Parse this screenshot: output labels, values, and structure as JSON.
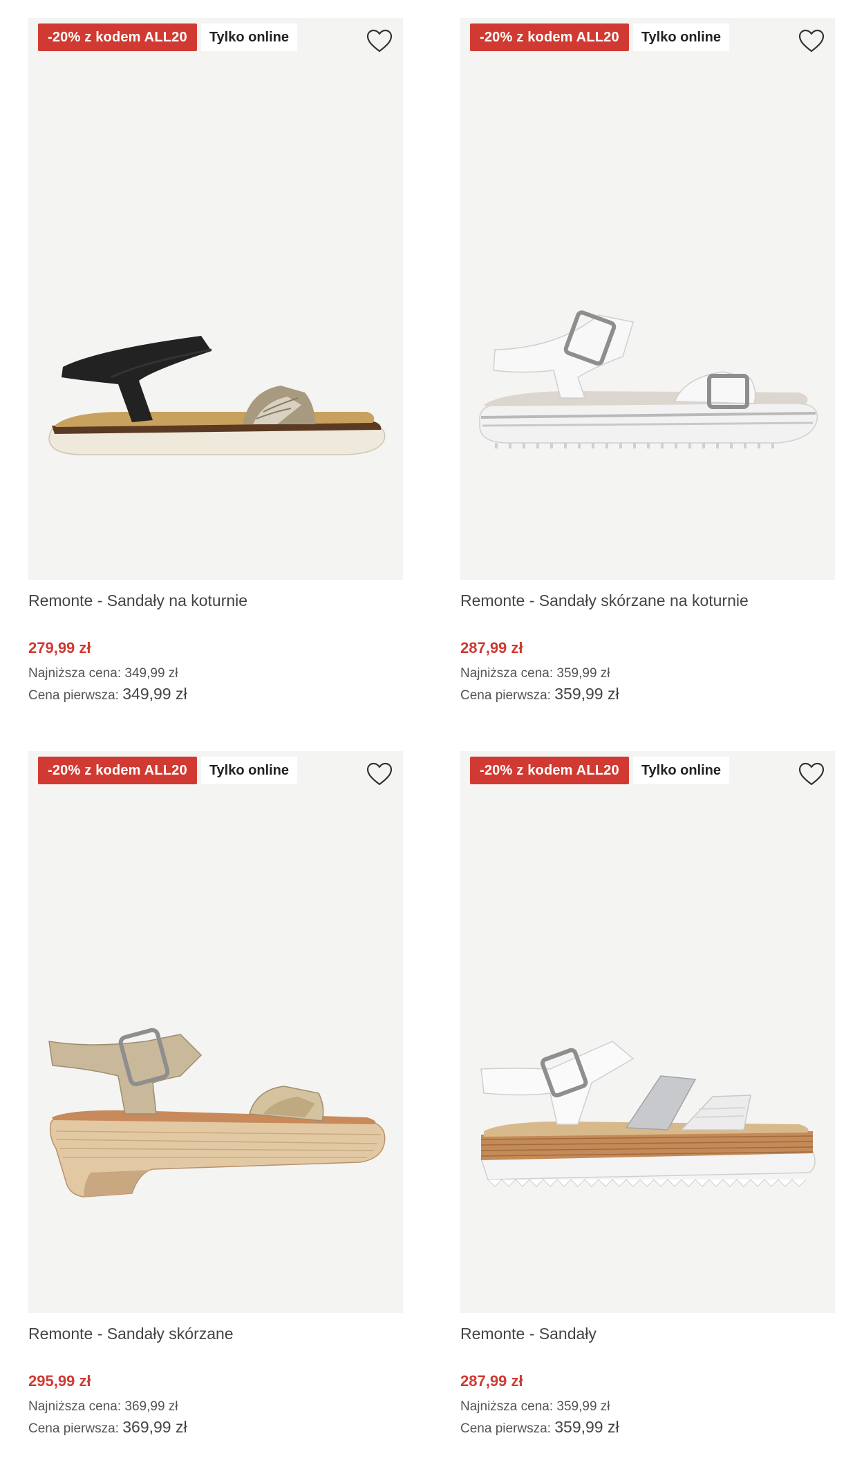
{
  "products": [
    {
      "promo_badge": "-20% z kodem ALL20",
      "online_badge": "Tylko online",
      "title": "Remonte - Sandały na koturnie",
      "price": "279,99 zł",
      "lowest_label": "Najniższa cena:",
      "lowest_value": "349,99 zł",
      "first_label": "Cena pierwsza:",
      "first_value": "349,99 zł"
    },
    {
      "promo_badge": "-20% z kodem ALL20",
      "online_badge": "Tylko online",
      "title": "Remonte - Sandały skórzane na koturnie",
      "price": "287,99 zł",
      "lowest_label": "Najniższa cena:",
      "lowest_value": "359,99 zł",
      "first_label": "Cena pierwsza:",
      "first_value": "359,99 zł"
    },
    {
      "promo_badge": "-20% z kodem ALL20",
      "online_badge": "Tylko online",
      "title": "Remonte - Sandały skórzane",
      "price": "295,99 zł",
      "lowest_label": "Najniższa cena:",
      "lowest_value": "369,99 zł",
      "first_label": "Cena pierwsza:",
      "first_value": "369,99 zł"
    },
    {
      "promo_badge": "-20% z kodem ALL20",
      "online_badge": "Tylko online",
      "title": "Remonte - Sandały",
      "price": "287,99 zł",
      "lowest_label": "Najniższa cena:",
      "lowest_value": "359,99 zł",
      "first_label": "Cena pierwsza:",
      "first_value": "359,99 zł"
    }
  ],
  "icons": {
    "favorite": "heart-outline-icon"
  },
  "colors": {
    "promo": "#d03a32",
    "price": "#d03a32",
    "tile_bg": "#f4f4f2"
  }
}
